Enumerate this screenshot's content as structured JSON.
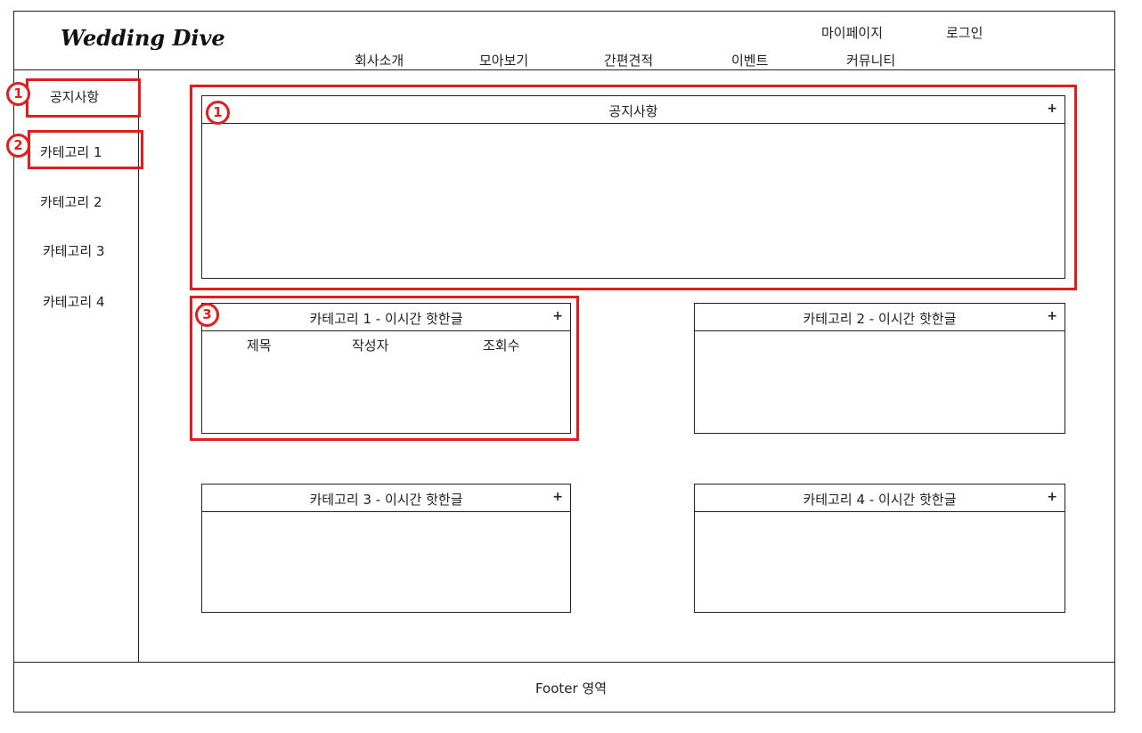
{
  "header": {
    "logo": "Wedding Dive",
    "nav_top": [
      "마이페이지",
      "로그인"
    ],
    "nav_main": [
      "회사소개",
      "모아보기",
      "간편견적",
      "이벤트",
      "커뮤니티"
    ]
  },
  "sidebar": {
    "items": [
      {
        "label": "공지사항"
      },
      {
        "label": "카테고리 1"
      },
      {
        "label": "카테고리 2"
      },
      {
        "label": "카테고리 3"
      },
      {
        "label": "카테고리 4"
      }
    ]
  },
  "main": {
    "notice": {
      "title": "공지사항",
      "plus": "+"
    },
    "boxes": [
      {
        "title": "카테고리 1 - 이시간 핫한글",
        "plus": "+",
        "columns": [
          "제목",
          "작성자",
          "조회수"
        ]
      },
      {
        "title": "카테고리 2 - 이시간 핫한글",
        "plus": "+"
      },
      {
        "title": "카테고리 3 - 이시간 핫한글",
        "plus": "+"
      },
      {
        "title": "카테고리 4 - 이시간 핫한글",
        "plus": "+"
      }
    ]
  },
  "annotations": {
    "badge_1": "1",
    "badge_2": "2",
    "badge_3": "3"
  },
  "footer": {
    "text": "Footer 영역"
  },
  "colors": {
    "annotation": "#e01e1e",
    "line": "#222222"
  }
}
